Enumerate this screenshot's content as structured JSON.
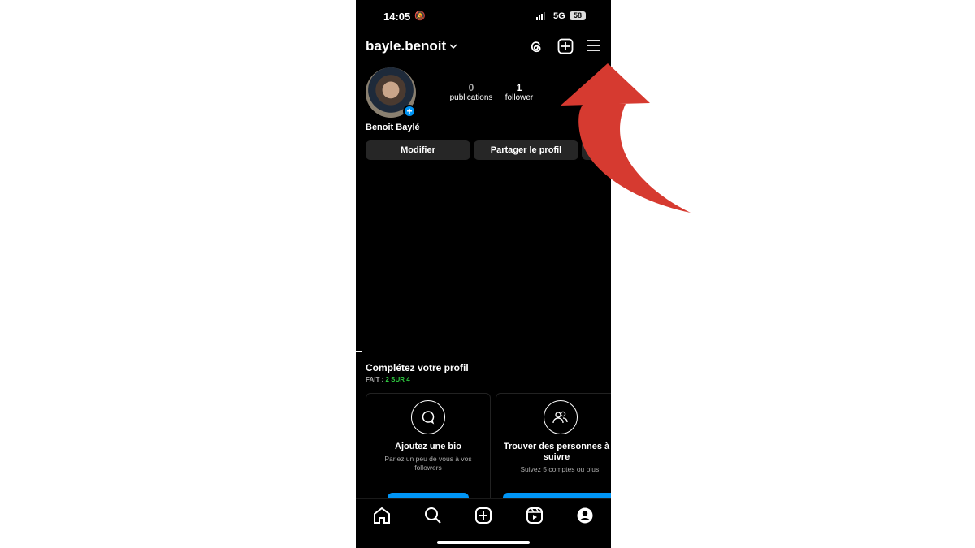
{
  "status_bar": {
    "time": "14:05",
    "network": "5G",
    "battery": "58",
    "icons": [
      "bell-slash-icon",
      "signal-icon",
      "battery-icon"
    ]
  },
  "header": {
    "username": "bayle.benoit",
    "icons": [
      "chevron-down-icon",
      "threads-icon",
      "plus-square-icon",
      "menu-icon"
    ]
  },
  "profile": {
    "display_name": "Benoit Baylé",
    "stats": [
      {
        "value": "0",
        "label": "publications"
      },
      {
        "value": "1",
        "label": "follower"
      }
    ]
  },
  "buttons": {
    "edit": "Modifier",
    "share": "Partager le profil"
  },
  "complete_profile": {
    "title": "Complétez votre profil",
    "progress_prefix": "FAIT :",
    "progress_value": "2 SUR 4",
    "progress_color": "#2ecc40",
    "cards": [
      {
        "title": "Ajoutez une bio",
        "subtitle": "Parlez un peu de vous à vos followers",
        "icon": "speech-bubble-icon"
      },
      {
        "title": "Trouver des personnes à suivre",
        "subtitle": "Suivez 5 comptes ou plus.",
        "icon": "people-icon"
      }
    ]
  },
  "tab_bar": [
    "home-icon",
    "search-icon",
    "create-icon",
    "reels-icon",
    "profile-icon"
  ],
  "annotation": {
    "arrow_color": "#d63a30",
    "points_to": "menu-icon"
  }
}
